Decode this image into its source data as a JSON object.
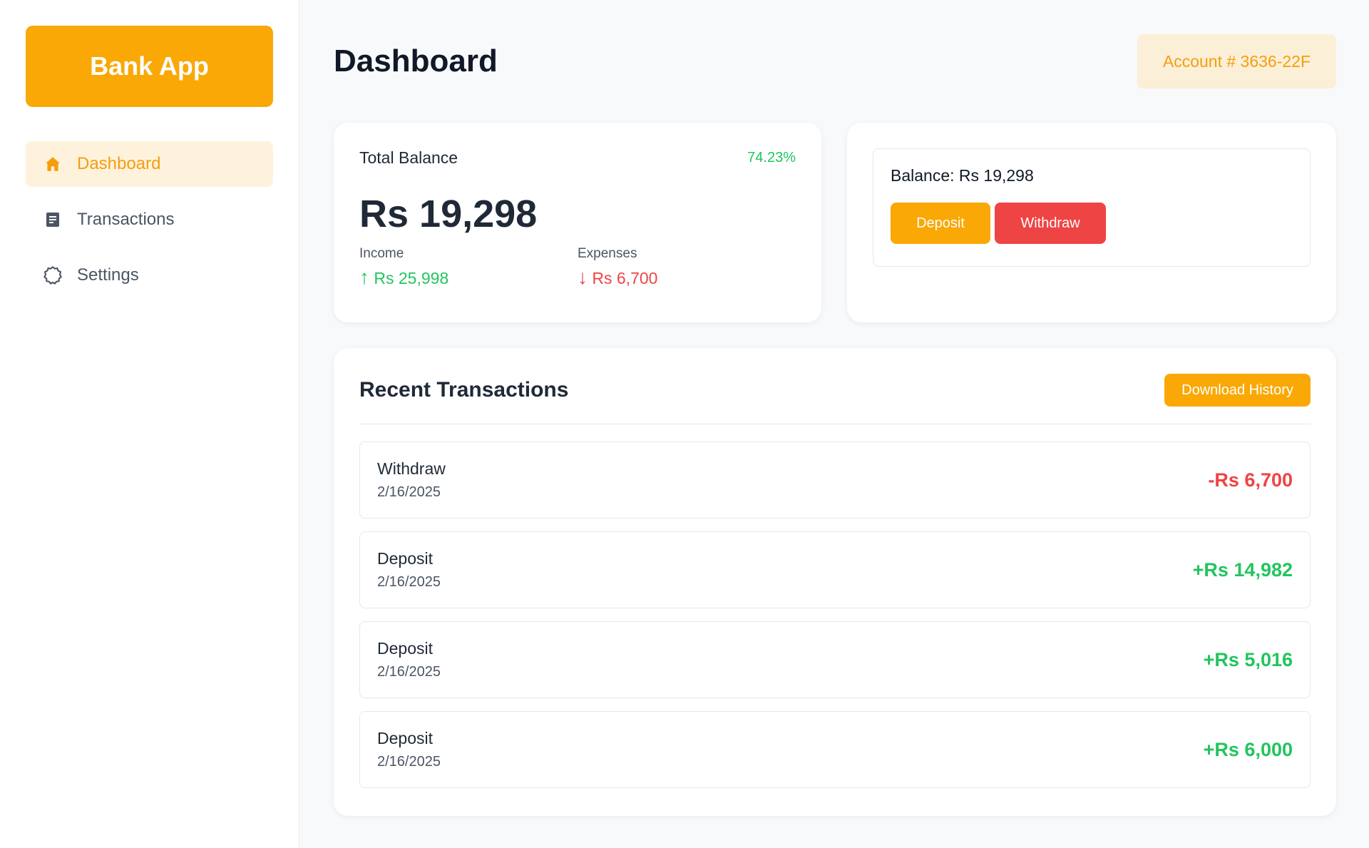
{
  "sidebar": {
    "logo": "Bank App",
    "items": [
      {
        "label": "Dashboard",
        "icon": "home-icon",
        "active": true
      },
      {
        "label": "Transactions",
        "icon": "document-icon",
        "active": false
      },
      {
        "label": "Settings",
        "icon": "gear-icon",
        "active": false
      }
    ]
  },
  "header": {
    "title": "Dashboard",
    "account": "Account # 3636-22F"
  },
  "balance_card": {
    "label": "Total Balance",
    "percent": "74.23%",
    "amount": "Rs 19,298",
    "income_label": "Income",
    "income_value": "Rs 25,998",
    "expense_label": "Expenses",
    "expense_value": "Rs 6,700"
  },
  "action_card": {
    "balance": "Balance: Rs 19,298",
    "deposit_label": "Deposit",
    "withdraw_label": "Withdraw"
  },
  "transactions": {
    "title": "Recent Transactions",
    "download_label": "Download History",
    "items": [
      {
        "type": "Withdraw",
        "date": "2/16/2025",
        "amount": "-Rs 6,700"
      },
      {
        "type": "Deposit",
        "date": "2/16/2025",
        "amount": "+Rs 14,982"
      },
      {
        "type": "Deposit",
        "date": "2/16/2025",
        "amount": "+Rs 5,016"
      },
      {
        "type": "Deposit",
        "date": "2/16/2025",
        "amount": "+Rs 6,000"
      }
    ]
  },
  "colors": {
    "accent": "#f9a806",
    "positive": "#22c55e",
    "negative": "#ef4444"
  }
}
